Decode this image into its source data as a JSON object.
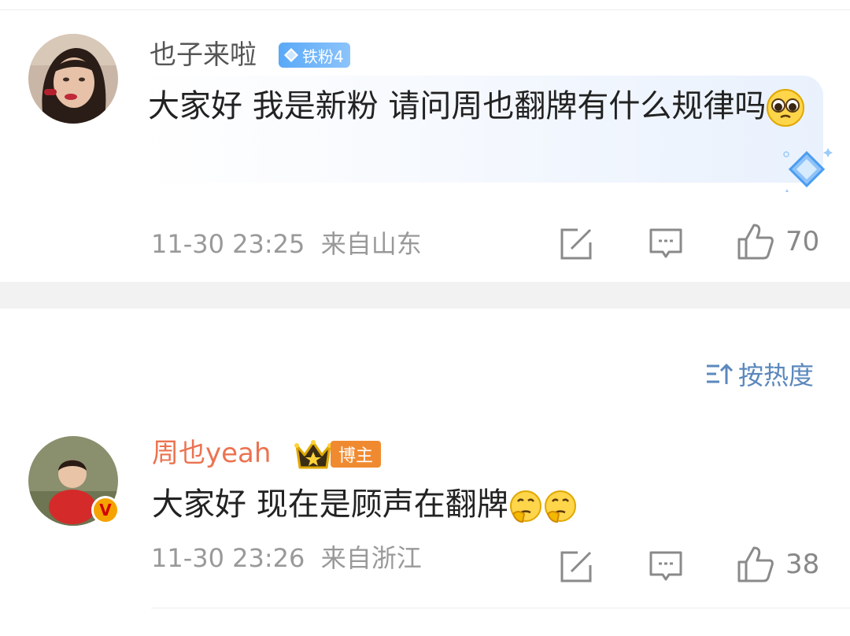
{
  "comments": [
    {
      "username": "也子来啦",
      "badge": "铁粉4",
      "text": "大家好 我是新粉 请问周也翻牌有什么规律吗",
      "time": "11-30 23:25",
      "location": "来自山东",
      "likes": "70"
    },
    {
      "username": "周也yeah",
      "badge": "博主",
      "text": "大家好 现在是顾声在翻牌",
      "time": "11-30 23:26",
      "location": "来自浙江",
      "likes": "38"
    }
  ],
  "sort_label": "按热度",
  "verified_mark": "V",
  "colors": {
    "username_default": "#555555",
    "username_host": "#eb7350",
    "sort_blue": "#5b88bd",
    "fan_badge": "#5aa9f7",
    "host_badge": "#f08a31",
    "meta_gray": "#999999"
  }
}
